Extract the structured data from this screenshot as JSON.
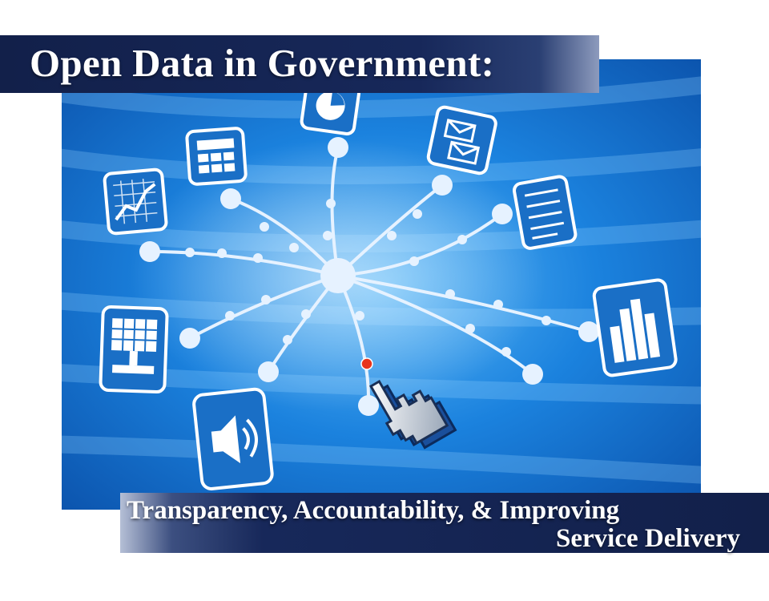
{
  "title": "Open Data in Government:",
  "subtitle": {
    "line1": "Transparency, Accountability, & Improving",
    "line2": "Service Delivery"
  },
  "colors": {
    "banner_navy": "#12204a",
    "network_blue": "#1473d0",
    "highlight_blue": "#49a8f3",
    "cursor_dot": "#e8341c"
  },
  "network_icons": [
    "pie-chart-icon",
    "table-icon",
    "line-chart-icon",
    "mail-icon",
    "document-list-icon",
    "monitor-grid-icon",
    "bar-chart-icon",
    "speaker-icon",
    "hand-pointer-icon"
  ]
}
